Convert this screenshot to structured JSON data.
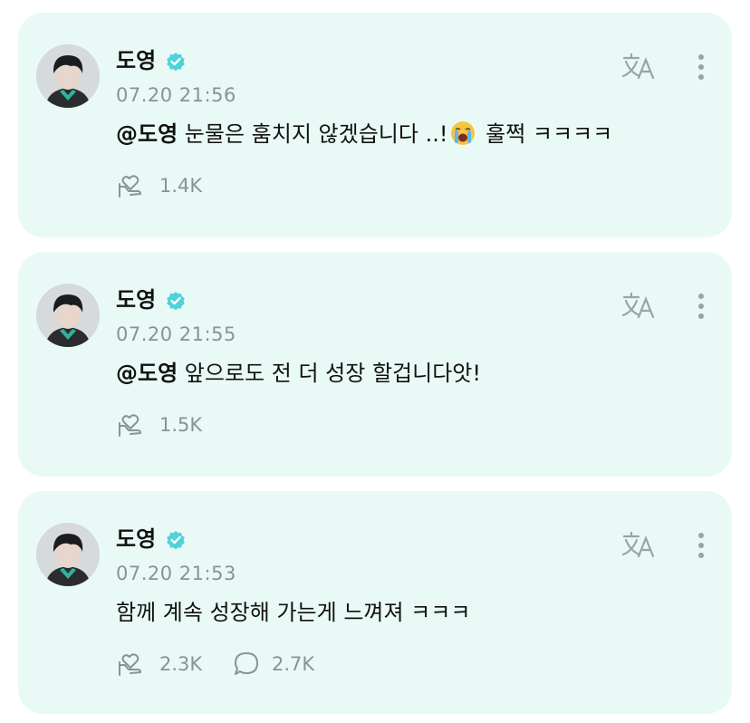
{
  "posts": [
    {
      "author": "도영",
      "time": "07.20 21:56",
      "mention": "@도영",
      "text_before_emoji": " 눈물은 훔치지 않겠습니다 ..!",
      "emoji": "loudly-crying-face",
      "text_after_emoji": " 훌쩍 ㅋㅋㅋㅋ",
      "likes": "1.4K"
    },
    {
      "author": "도영",
      "time": "07.20 21:55",
      "mention": "@도영",
      "text": " 앞으로도 전 더 성장 할겁니다앗!",
      "likes": "1.5K"
    },
    {
      "author": "도영",
      "time": "07.20 21:53",
      "text": "함께 계속 성장해 가는게 느껴져 ㅋㅋㅋ",
      "likes": "2.3K",
      "comments": "2.7K"
    }
  ],
  "icons": {
    "verified": "verified-badge-icon",
    "translate": "translate-icon",
    "more": "more-vertical-icon",
    "like": "heart-hand-icon",
    "comment": "comment-bubble-icon"
  },
  "colors": {
    "card_background": "#e9faf6",
    "verified": "#4fd3d8",
    "muted": "#8b9296"
  }
}
